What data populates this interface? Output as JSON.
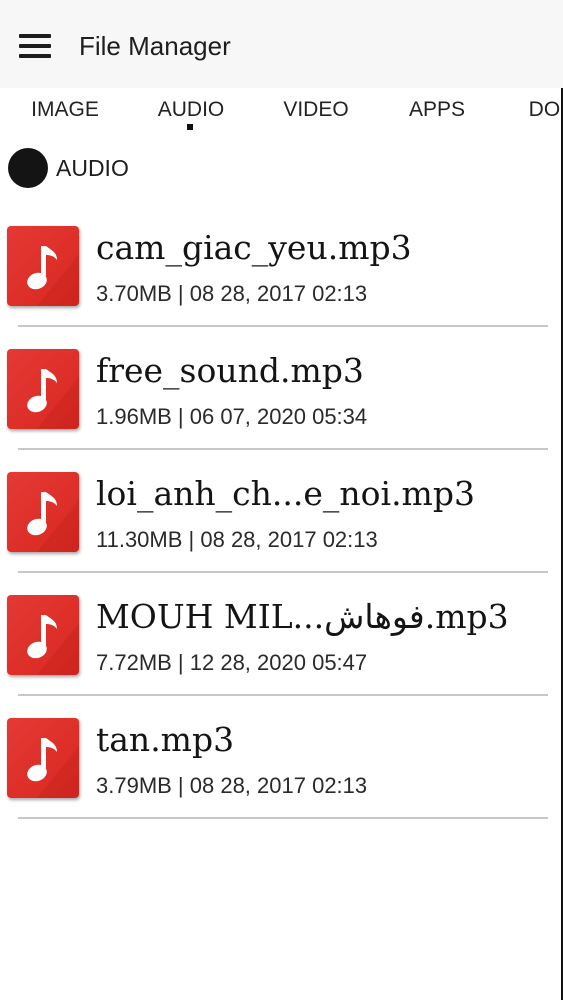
{
  "app_bar": {
    "title": "File Manager",
    "menu_icon": "hamburger-menu-icon"
  },
  "tabs": [
    {
      "label": "IMAGE",
      "active": false
    },
    {
      "label": "AUDIO",
      "active": true
    },
    {
      "label": "VIDEO",
      "active": false
    },
    {
      "label": "APPS",
      "active": false
    },
    {
      "label": "DOC",
      "active": false
    }
  ],
  "section": {
    "label": "AUDIO"
  },
  "files": [
    {
      "name": "cam_giac_yeu.mp3",
      "meta": "3.70MB | 08 28, 2017 02:13",
      "icon": "music-note-icon"
    },
    {
      "name": "free_sound.mp3",
      "meta": "1.96MB | 06 07, 2020 05:34",
      "icon": "music-note-icon"
    },
    {
      "name": "loi_anh_ch...e_noi.mp3",
      "meta": "11.30MB | 08 28, 2017 02:13",
      "icon": "music-note-icon"
    },
    {
      "name": "MOUH MIL...فوهاش.mp3",
      "meta": "7.72MB | 12 28, 2020 05:47",
      "icon": "music-note-icon"
    },
    {
      "name": "tan.mp3",
      "meta": "3.79MB | 08 28, 2017 02:13",
      "icon": "music-note-icon"
    }
  ],
  "colors": {
    "icon_red": "#e53935",
    "app_bar_bg": "#f7f7f7",
    "divider": "#c8c8c8"
  }
}
